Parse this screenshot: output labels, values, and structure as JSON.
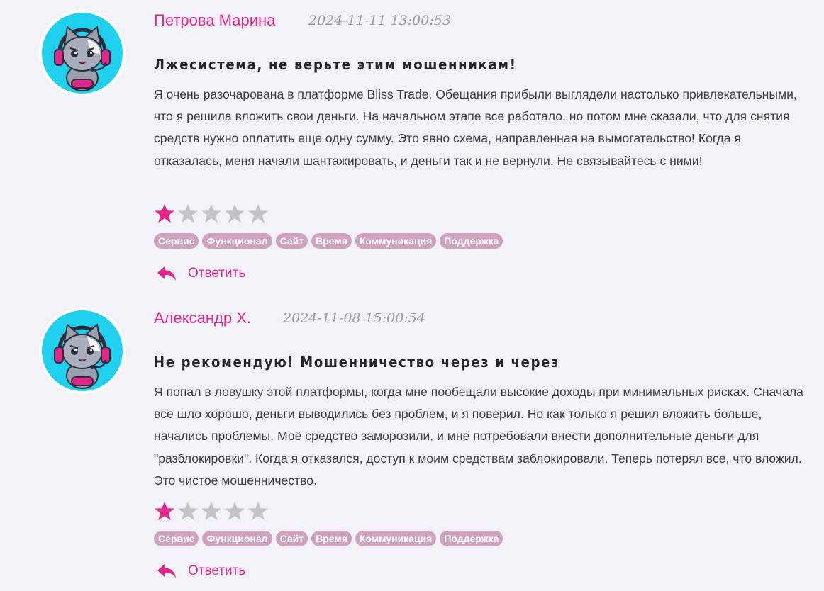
{
  "reviews": [
    {
      "author": "Петрова Марина",
      "date": "2024-11-11 13:00:53",
      "title": "Лжесистема, не верьте этим мошенникам!",
      "body": "Я очень разочарована в платформе Bliss Trade. Обещания прибыли выглядели настолько привлекательными, что я решила вложить свои деньги. На начальном этапе все работало, но потом мне сказали, что для снятия средств нужно оплатить еще одну сумму. Это явно схема, направленная на вымогательство! Когда я отказалась, меня начали шантажировать, и деньги так и не вернули. Не связывайтесь с ними!",
      "rating": 1,
      "rating_max": 5,
      "tags": [
        "Сервис",
        "Функционал",
        "Сайт",
        "Время",
        "Коммуникация",
        "Поддержка"
      ],
      "reply_label": "Ответить"
    },
    {
      "author": "Александр Х.",
      "date": "2024-11-08 15:00:54",
      "title": "Не рекомендую! Мошенничество через и через",
      "body": "Я попал в ловушку этой платформы, когда мне пообещали высокие доходы при минимальных рисках. Сначала все шло хорошо, деньги выводились без проблем, и я поверил. Но как только я решил вложить больше, начались проблемы. Моё средство заморозили, и мне потребовали внести дополнительные деньги для \"разблокировки\". Когда я отказался, доступ к моим средствам заблокировали. Теперь потерял все, что вложил. Это чистое мошенничество.",
      "rating": 1,
      "rating_max": 5,
      "tags": [
        "Сервис",
        "Функционал",
        "Сайт",
        "Время",
        "Коммуникация",
        "Поддержка"
      ],
      "reply_label": "Ответить"
    }
  ],
  "colors": {
    "accent": "#e4268c",
    "star_filled": "#e4268c",
    "star_empty": "#c4c4c4",
    "tag_bg": "#cfa2bd",
    "background": "#f2f2f8",
    "avatar_ring": "#1fd0ef"
  },
  "icons": {
    "avatar": "cat-gamer-avatar-icon",
    "star": "star-icon",
    "reply": "reply-arrow-icon"
  }
}
